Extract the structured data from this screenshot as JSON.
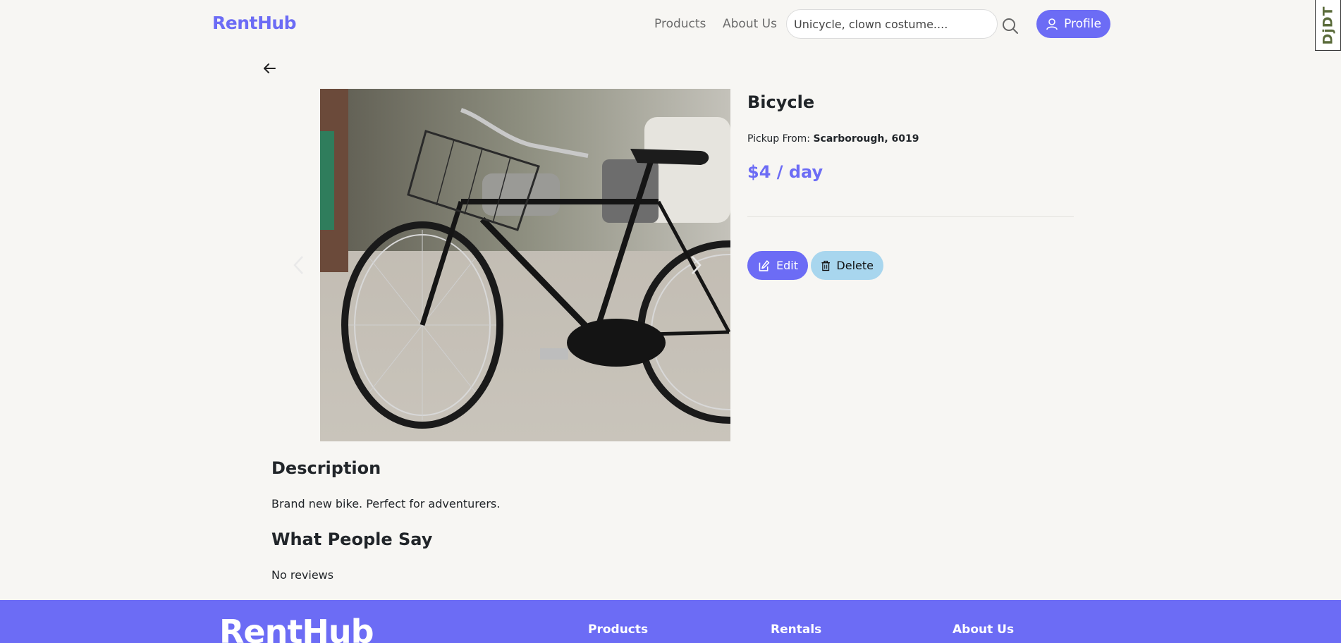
{
  "header": {
    "brand": "RentHub",
    "nav": {
      "products": "Products",
      "about": "About Us"
    },
    "search": {
      "placeholder": "Unicycle, clown costume....",
      "value": ""
    },
    "profile_label": "Profile"
  },
  "debug_toolbar": {
    "label": "DjDT"
  },
  "product": {
    "title": "Bicycle",
    "pickup_label": "Pickup From:",
    "pickup_location": "Scarborough, 6019",
    "price": "$4 / day",
    "actions": {
      "edit": "Edit",
      "delete": "Delete"
    }
  },
  "description": {
    "heading": "Description",
    "text": "Brand new bike. Perfect for adventurers."
  },
  "reviews": {
    "heading": "What People Say",
    "empty_text": "No reviews"
  },
  "footer": {
    "brand": "RentHub",
    "columns": [
      "Products",
      "Rentals",
      "About Us"
    ]
  },
  "colors": {
    "accent": "#6c6cf5",
    "delete_button": "#a8d6ee",
    "background": "#f7f6f3"
  }
}
